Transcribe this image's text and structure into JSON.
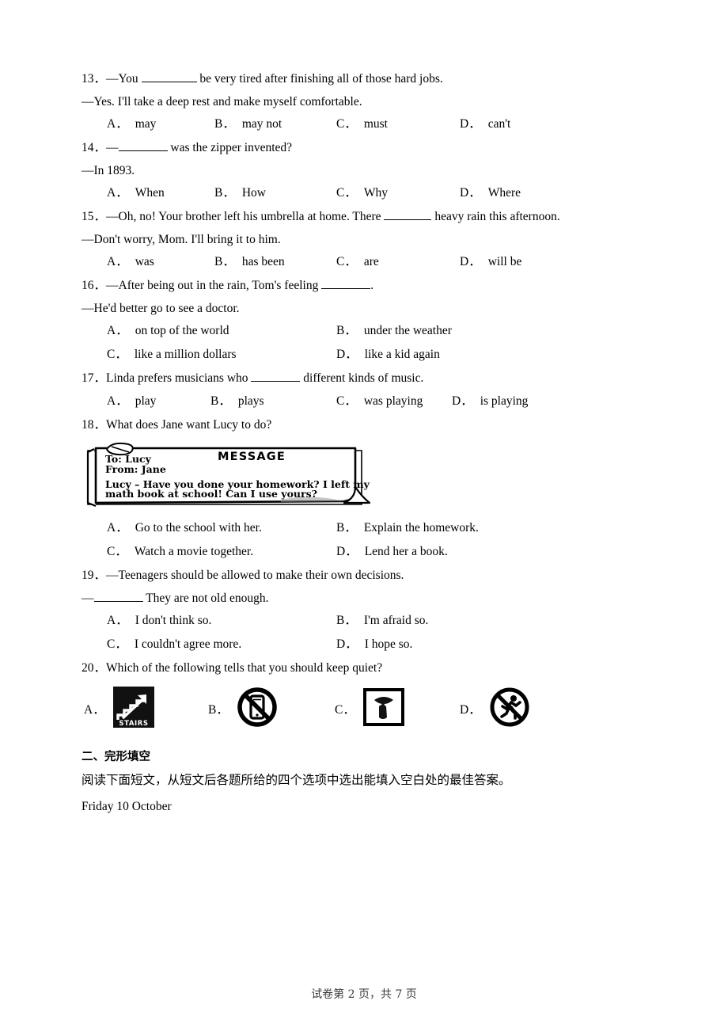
{
  "document": {
    "footer": "试卷第 2 页，共 7 页"
  },
  "questions": [
    {
      "number": "13．",
      "stem_prefix": "—You ",
      "stem_suffix": " be very tired after finishing all of those hard jobs.",
      "reply": "—Yes. I'll take a deep rest and make myself comfortable.",
      "layout": "four-column",
      "options": [
        {
          "label": "A．",
          "text": "may"
        },
        {
          "label": "B．",
          "text": "may not"
        },
        {
          "label": "C．",
          "text": "must"
        },
        {
          "label": "D．",
          "text": "can't"
        }
      ]
    },
    {
      "number": "14．",
      "stem_prefix": "—",
      "stem_suffix": " was the zipper invented?",
      "reply": "—In 1893.",
      "layout": "four-column",
      "options": [
        {
          "label": "A．",
          "text": "When"
        },
        {
          "label": "B．",
          "text": "How"
        },
        {
          "label": "C．",
          "text": "Why"
        },
        {
          "label": "D．",
          "text": "Where"
        }
      ]
    },
    {
      "number": "15．",
      "stem_prefix": "—Oh, no! Your brother left his umbrella at home. There ",
      "stem_suffix": " heavy rain this afternoon.",
      "reply": "—Don't worry, Mom. I'll bring it to him.",
      "layout": "four-column",
      "options": [
        {
          "label": "A．",
          "text": "was"
        },
        {
          "label": "B．",
          "text": "has been"
        },
        {
          "label": "C．",
          "text": "are"
        },
        {
          "label": "D．",
          "text": "will be"
        }
      ]
    },
    {
      "number": "16．",
      "stem_prefix": "—After being out in the rain, Tom's feeling ",
      "stem_suffix": ".",
      "reply": "—He'd better go to see a doctor.",
      "layout": "two-column",
      "options": [
        {
          "label": "A．",
          "text": "on top of the world"
        },
        {
          "label": "B．",
          "text": "under the weather"
        },
        {
          "label": "C．",
          "text": "like a million dollars"
        },
        {
          "label": "D．",
          "text": "like a kid again"
        }
      ]
    },
    {
      "number": "17．",
      "stem_prefix": "Linda prefers musicians who ",
      "stem_suffix": " different kinds of music.",
      "reply": "",
      "layout": "four-column-narrow",
      "options": [
        {
          "label": "A．",
          "text": "play"
        },
        {
          "label": "B．",
          "text": "plays"
        },
        {
          "label": "C．",
          "text": "was playing"
        },
        {
          "label": "D．",
          "text": "is playing"
        }
      ]
    },
    {
      "number": "18．",
      "stem_prefix": "What does Jane want Lucy to do?",
      "stem_suffix": "",
      "reply": "",
      "layout": "two-column",
      "options": [
        {
          "label": "A．",
          "text": "Go to the school with her."
        },
        {
          "label": "B．",
          "text": "Explain the homework."
        },
        {
          "label": "C．",
          "text": "Watch a movie together."
        },
        {
          "label": "D．",
          "text": "Lend her a book."
        }
      ]
    },
    {
      "number": "19．",
      "stem_prefix": "—Teenagers should be allowed to make their own decisions.",
      "stem_suffix": "",
      "reply": " They are not old enough.",
      "layout": "two-column",
      "options": [
        {
          "label": "A．",
          "text": "I don't think so."
        },
        {
          "label": "B．",
          "text": "I'm afraid so."
        },
        {
          "label": "C．",
          "text": "I couldn't agree more."
        },
        {
          "label": "D．",
          "text": "I hope so."
        }
      ]
    },
    {
      "number": "20．",
      "stem_prefix": "Which of the following tells that you should keep quiet?",
      "stem_suffix": "",
      "reply": "",
      "layout": "image-options",
      "options": [
        {
          "label": "A．",
          "text": "",
          "icon": "stairs-sign-icon"
        },
        {
          "label": "B．",
          "text": "",
          "icon": "no-mobile-phone-sign-icon"
        },
        {
          "label": "C．",
          "text": "",
          "icon": "quiet-shh-sign-icon"
        },
        {
          "label": "D．",
          "text": "",
          "icon": "no-running-sign-icon"
        }
      ]
    }
  ],
  "message_note": {
    "title": "MESSAGE",
    "to_line": "To: Lucy",
    "from_line": "From: Jane",
    "body_line1": "Lucy – Have you done your homework? I left my",
    "body_line2": "math book at school! Can I use yours?"
  },
  "stairs_sign": {
    "caption": "STAIRS"
  },
  "cloze_section": {
    "heading": "二、完形填空",
    "instruction": "阅读下面短文，从短文后各题所给的四个选项中选出能填入空白处的最佳答案。",
    "passage_date": "Friday 10 October"
  }
}
